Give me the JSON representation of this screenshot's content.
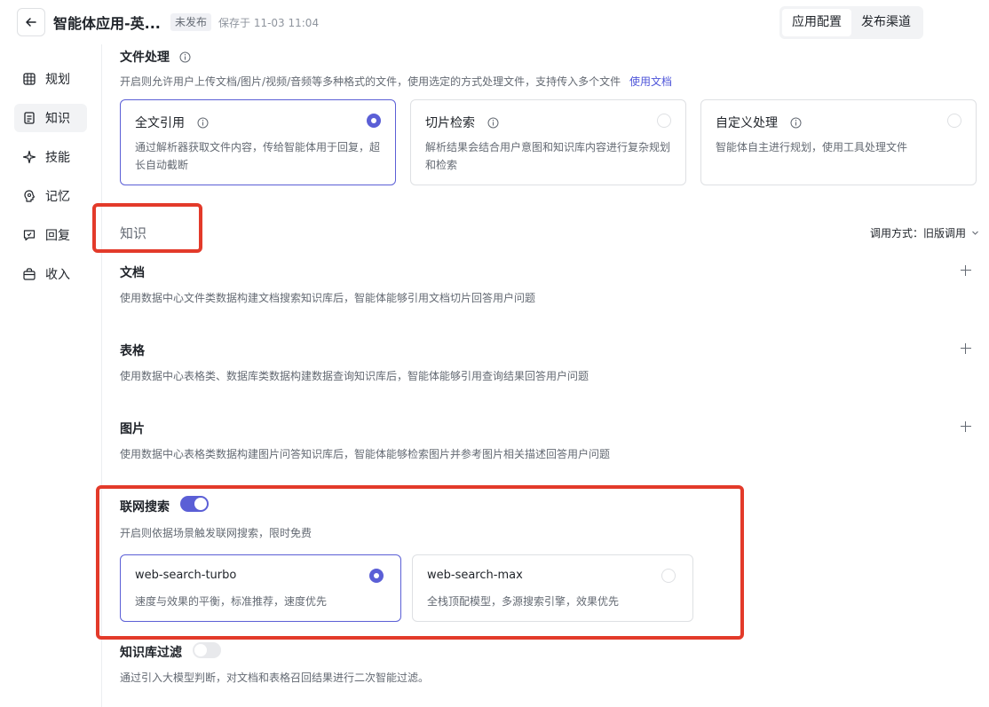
{
  "header": {
    "title": "智能体应用-英...",
    "status": "未发布",
    "saved": "保存于 11-03 11:04",
    "tabs": [
      {
        "label": "应用配置",
        "active": true
      },
      {
        "label": "发布渠道",
        "active": false
      }
    ]
  },
  "sidebar": {
    "items": [
      {
        "label": "规划",
        "icon": "grid-icon"
      },
      {
        "label": "知识",
        "icon": "document-icon",
        "active": true
      },
      {
        "label": "技能",
        "icon": "sparkle-icon"
      },
      {
        "label": "记忆",
        "icon": "brain-icon"
      },
      {
        "label": "回复",
        "icon": "chat-icon"
      },
      {
        "label": "收入",
        "icon": "bag-icon"
      }
    ]
  },
  "file_processing": {
    "title": "文件处理",
    "desc": "开启则允许用户上传文档/图片/视频/音频等多种格式的文件，使用选定的方式处理文件，支持传入多个文件",
    "link": "使用文档",
    "options": [
      {
        "title": "全文引用",
        "desc": "通过解析器获取文件内容，传给智能体用于回复，超长自动截断",
        "selected": true
      },
      {
        "title": "切片检索",
        "desc": "解析结果会结合用户意图和知识库内容进行复杂规划和检索",
        "selected": false
      },
      {
        "title": "自定义处理",
        "desc": "智能体自主进行规划，使用工具处理文件",
        "selected": false
      }
    ]
  },
  "knowledge": {
    "heading": "知识",
    "call_mode": "调用方式：旧版调用",
    "sections": [
      {
        "title": "文档",
        "desc": "使用数据中心文件类数据构建文档搜索知识库后，智能体能够引用文档切片回答用户问题"
      },
      {
        "title": "表格",
        "desc": "使用数据中心表格类、数据库类数据构建数据查询知识库后，智能体能够引用查询结果回答用户问题"
      },
      {
        "title": "图片",
        "desc": "使用数据中心表格类数据构建图片问答知识库后，智能体能够检索图片并参考图片相关描述回答用户问题"
      }
    ]
  },
  "web_search": {
    "title": "联网搜索",
    "enabled": true,
    "desc": "开启则依据场景触发联网搜索，限时免费",
    "options": [
      {
        "title": "web-search-turbo",
        "desc": "速度与效果的平衡，标准推荐，速度优先",
        "selected": true
      },
      {
        "title": "web-search-max",
        "desc": "全栈顶配模型，多源搜索引擎，效果优先",
        "selected": false
      }
    ]
  },
  "kb_filter": {
    "title": "知识库过滤",
    "enabled": false,
    "desc": "通过引入大模型判断，对文档和表格召回结果进行二次智能过滤。"
  },
  "colors": {
    "accent": "#5b5fd6",
    "annotation": "#e33a2a",
    "link": "#4e55d9"
  }
}
